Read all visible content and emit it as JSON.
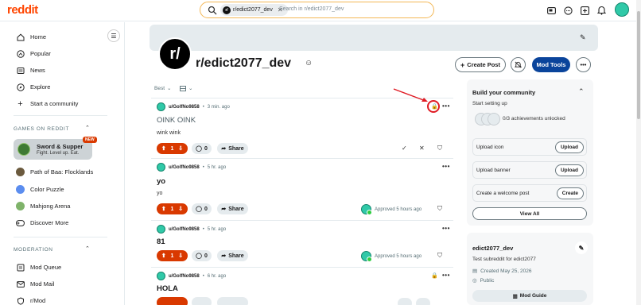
{
  "app": {
    "logo": "reddit"
  },
  "search": {
    "chip": "r/edict2077_dev",
    "placeholder": "Search in r/edict2077_dev"
  },
  "sidebar": {
    "nav": [
      {
        "label": "Home",
        "icon": "home-icon"
      },
      {
        "label": "Popular",
        "icon": "popular-icon"
      },
      {
        "label": "News",
        "icon": "news-icon"
      },
      {
        "label": "Explore",
        "icon": "explore-icon"
      },
      {
        "label": "Start a community",
        "icon": "plus-icon"
      }
    ],
    "games_title": "GAMES ON REDDIT",
    "featured_game": {
      "title": "Sword & Supper",
      "subtitle": "Fight. Level up. Eat.",
      "badge": "NEW"
    },
    "games": [
      {
        "label": "Path of Baa: Flocklands",
        "color": "#6b5a3e"
      },
      {
        "label": "Color Puzzle",
        "color": "#5b8def"
      },
      {
        "label": "Mahjong Arena",
        "color": "#7fb36a"
      },
      {
        "label": "Discover More",
        "color": "#333333"
      }
    ],
    "moderation_title": "MODERATION",
    "moderation": [
      {
        "label": "Mod Queue"
      },
      {
        "label": "Mod Mail"
      },
      {
        "label": "r/Mod"
      }
    ]
  },
  "subreddit": {
    "avatar_text": "r/",
    "name": "r/edict2077_dev",
    "create_post": "Create Post",
    "mod_tools": "Mod Tools"
  },
  "sort": {
    "label": "Best"
  },
  "posts": [
    {
      "user": "u/GolfNo9858",
      "time": "3 min. ago",
      "title": "OINK OINK",
      "body": "wink wink",
      "votes": "1",
      "comments": "0",
      "share": "Share",
      "approved": ""
    },
    {
      "user": "u/GolfNo9858",
      "time": "5 hr. ago",
      "title": "yo",
      "body": "yo",
      "votes": "1",
      "comments": "0",
      "share": "Share",
      "approved": "Approved 5 hours ago"
    },
    {
      "user": "u/GolfNo9858",
      "time": "5 hr. ago",
      "title": "81",
      "body": "",
      "votes": "1",
      "comments": "0",
      "share": "Share",
      "approved": "Approved 5 hours ago"
    },
    {
      "user": "u/GolfNo9858",
      "time": "6 hr. ago",
      "title": "HOLA",
      "body": "",
      "votes": "",
      "comments": "",
      "share": "",
      "approved": ""
    }
  ],
  "build": {
    "title": "Build your community",
    "subtitle": "Start setting up",
    "achievements": "0/3 achievements unlocked",
    "rows": [
      {
        "label": "Upload icon",
        "button": "Upload"
      },
      {
        "label": "Upload banner",
        "button": "Upload"
      },
      {
        "label": "Create a welcome post",
        "button": "Create"
      }
    ],
    "view_all": "View All"
  },
  "about": {
    "name": "edict2077_dev",
    "description": "Test subreddit for edict2077",
    "created": "Created May 25, 2026",
    "visibility": "Public",
    "mod_guide": "Mod Guide"
  },
  "colors": {
    "brand": "#ff4500",
    "mod_tools": "#0a449b",
    "upvote": "#d93900",
    "annotation": "#e01b24"
  }
}
